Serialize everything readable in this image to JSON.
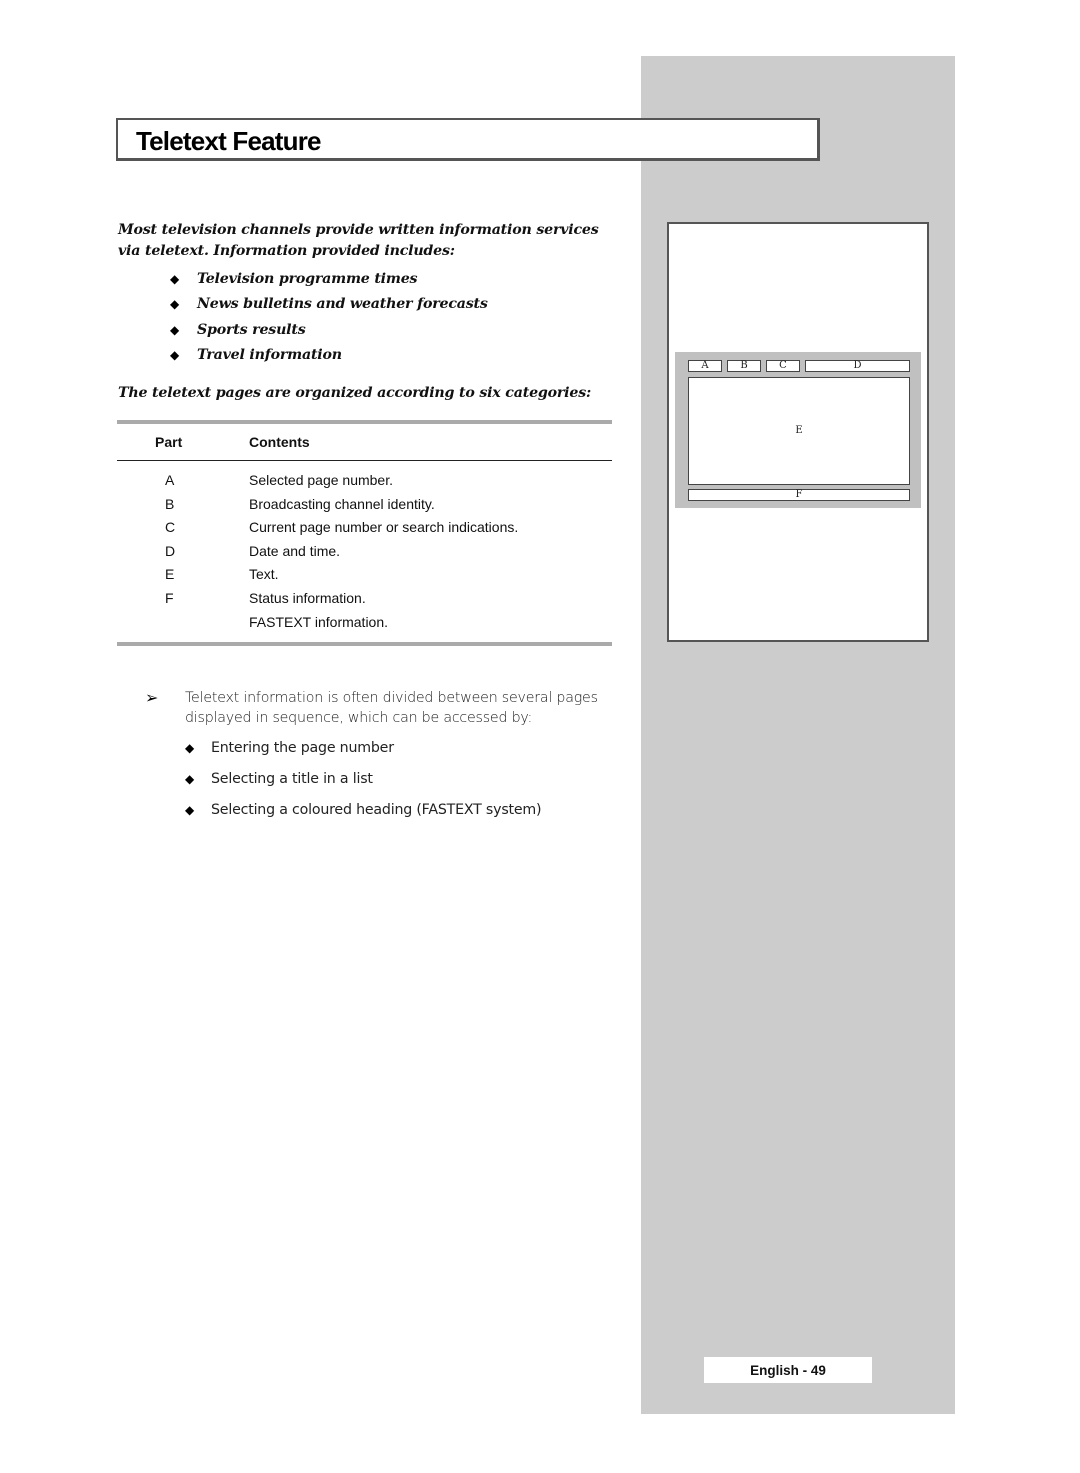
{
  "page": {
    "title": "Teletext Feature",
    "footer": "English - 49"
  },
  "intro": {
    "text": "Most television channels provide written information services via teletext. Information provided includes:",
    "bullets": [
      "Television programme times",
      "News bulletins and weather forecasts",
      "Sports results",
      "Travel information"
    ],
    "bullet_icon": "diamond-bullet-icon"
  },
  "categories": {
    "heading": "The teletext pages are organized according to six categories:",
    "table": {
      "headers": [
        "Part",
        "Contents"
      ],
      "rows": [
        {
          "part": "A",
          "contents": "Selected page number."
        },
        {
          "part": "B",
          "contents": "Broadcasting channel identity."
        },
        {
          "part": "C",
          "contents": "Current page number or search indications."
        },
        {
          "part": "D",
          "contents": "Date and time."
        },
        {
          "part": "E",
          "contents": "Text."
        },
        {
          "part": "F",
          "contents": "Status information."
        },
        {
          "part": "",
          "contents": "FASTEXT information."
        }
      ]
    }
  },
  "note": {
    "icon": "arrow-right-icon",
    "symbol": "➢",
    "text": "Teletext information is often divided between several pages displayed in sequence, which can be accessed by:",
    "bullets": [
      "Entering the page number",
      "Selecting a title in a list",
      "Selecting a coloured heading (FASTEXT system)"
    ]
  },
  "diagram": {
    "labels": {
      "a": "A",
      "b": "B",
      "c": "C",
      "d": "D",
      "e": "E",
      "f": "F"
    }
  },
  "colors": {
    "sidebar": "#cccccc",
    "diagram_panel": "#c0c0c0",
    "border": "#555555"
  }
}
